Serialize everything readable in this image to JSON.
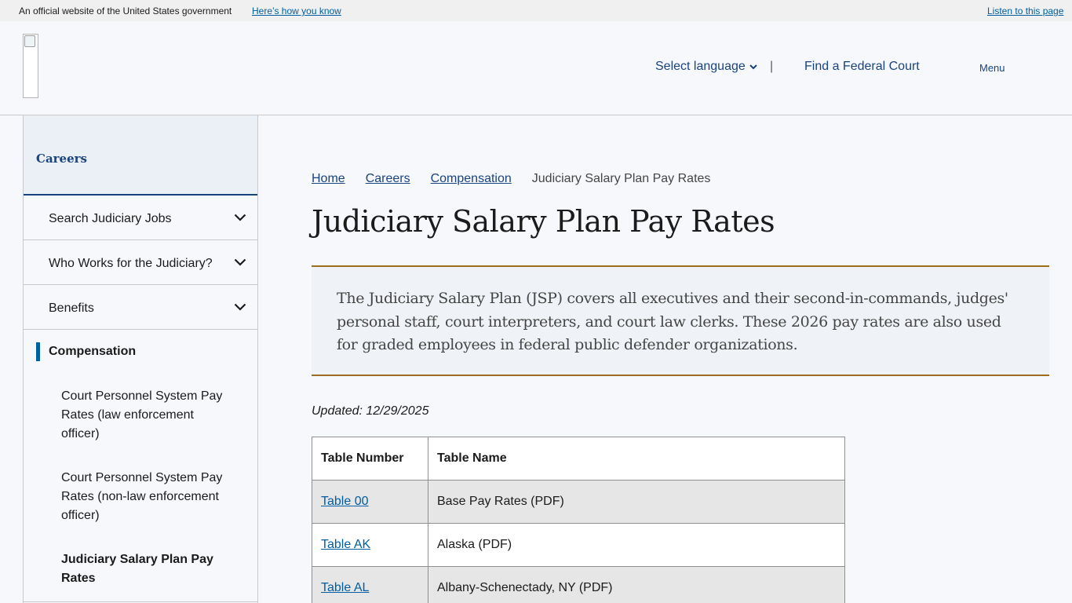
{
  "gov_banner": {
    "official_text": "An official website of the United States government",
    "how_link": "Here’s how you know",
    "listen_link": "Listen to this page"
  },
  "header": {
    "select_language": "Select language",
    "separator": "|",
    "find_court": "Find a Federal Court",
    "menu": "Menu"
  },
  "sidebar": {
    "title": "Careers",
    "items": [
      {
        "label": "Search Judiciary Jobs"
      },
      {
        "label": "Who Works for the Judiciary?"
      },
      {
        "label": "Benefits"
      }
    ],
    "current_section": "Compensation",
    "sub_items": [
      {
        "label": "Court Personnel System Pay Rates (law enforcement officer)"
      },
      {
        "label": "Court Personnel System Pay Rates (non-law enforcement officer)"
      },
      {
        "label": "Judiciary Salary Plan Pay Rates"
      }
    ]
  },
  "breadcrumb": {
    "items": [
      "Home",
      "Careers",
      "Compensation"
    ],
    "current": "Judiciary Salary Plan Pay Rates"
  },
  "main": {
    "title": "Judiciary Salary Plan Pay Rates",
    "intro": "The Judiciary Salary Plan (JSP) covers all executives and their second-in-commands, judges' personal staff, court interpreters, and court law clerks. These 2026 pay rates are also used for graded employees in federal public defender organizations.",
    "updated": "Updated: 12/29/2025"
  },
  "table": {
    "headers": [
      "Table Number",
      "Table Name"
    ],
    "rows": [
      {
        "number": "Table 00",
        "name": "Base Pay Rates (PDF)"
      },
      {
        "number": "Table AK",
        "name": "Alaska (PDF)"
      },
      {
        "number": "Table AL",
        "name": "Albany-Schenectady, NY (PDF)"
      }
    ]
  },
  "colors": {
    "link": "#005ea2",
    "nav_blue": "#1a4480",
    "intro_border": "#9c6d1f"
  }
}
